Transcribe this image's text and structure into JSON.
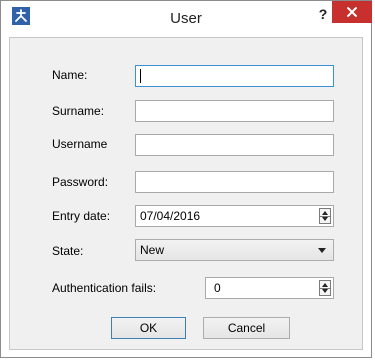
{
  "window": {
    "title": "User",
    "help_label": "?"
  },
  "form": {
    "name_label": "Name:",
    "surname_label": "Surname:",
    "username_label": "Username",
    "password_label": "Password:",
    "entry_date_label": "Entry date:",
    "entry_date_value": "07/04/2016",
    "state_label": "State:",
    "state_value": "New",
    "auth_fails_label": "Authentication fails:",
    "auth_fails_value": "0"
  },
  "buttons": {
    "ok_label": "OK",
    "cancel_label": "Cancel"
  },
  "colors": {
    "close_button": "#c7302c",
    "focus_border": "#3a8fd6",
    "default_button_border": "#3c7fb1"
  }
}
